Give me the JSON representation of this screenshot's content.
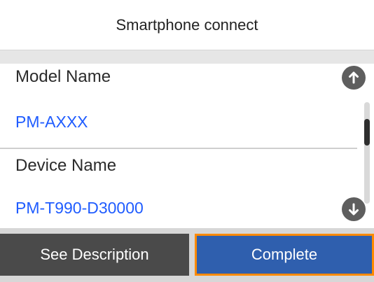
{
  "header": {
    "title": "Smartphone connect"
  },
  "details": {
    "model_name_label": "Model Name",
    "model_name_value": "PM-AXXX",
    "device_name_label": "Device Name",
    "device_name_value": "PM-T990-D30000"
  },
  "buttons": {
    "secondary": "See Description",
    "primary": "Complete"
  },
  "icons": {
    "up": "arrow-up-icon",
    "down": "arrow-down-icon"
  },
  "colors": {
    "value_text": "#1f5cff",
    "primary_button": "#2f5fae",
    "highlight_border": "#ff8a00"
  }
}
